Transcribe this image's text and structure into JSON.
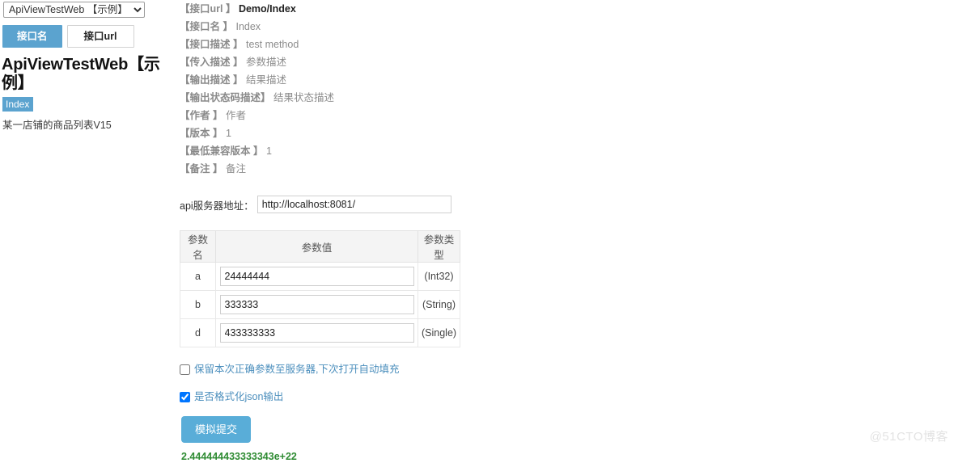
{
  "sidebar": {
    "select": {
      "selected": "ApiViewTestWeb 【示例】",
      "options": [
        "ApiViewTestWeb 【示例】"
      ]
    },
    "tabs": [
      {
        "label": "接口名",
        "active": true
      },
      {
        "label": "接口url",
        "active": false
      }
    ],
    "title": "ApiViewTestWeb【示例】",
    "badge": "Index",
    "description": "某一店铺的商品列表V15"
  },
  "main": {
    "meta": [
      {
        "key": "【接口url 】",
        "value": "Demo/Index",
        "strong": true
      },
      {
        "key": "【接口名 】",
        "value": "Index",
        "strong": false
      },
      {
        "key": "【接口描述 】",
        "value": "test method",
        "strong": false
      },
      {
        "key": "【传入描述 】",
        "value": "参数描述",
        "strong": false
      },
      {
        "key": "【输出描述 】",
        "value": "结果描述",
        "strong": false
      },
      {
        "key": "【输出状态码描述】",
        "value": "结果状态描述",
        "strong": false
      },
      {
        "key": "【作者 】",
        "value": "作者",
        "strong": false
      },
      {
        "key": "【版本 】",
        "value": "1",
        "strong": false
      },
      {
        "key": "【最低兼容版本 】",
        "value": "1",
        "strong": false
      },
      {
        "key": "【备注 】",
        "value": "备注",
        "strong": false
      }
    ],
    "server": {
      "label": "api服务器地址：",
      "value": "http://localhost:8081/"
    },
    "table": {
      "headers": [
        "参数名",
        "参数值",
        "参数类型"
      ],
      "rows": [
        {
          "name": "a",
          "value": "24444444",
          "type": "(Int32)"
        },
        {
          "name": "b",
          "value": "333333",
          "type": "(String)"
        },
        {
          "name": "d",
          "value": "433333333",
          "type": "(Single)"
        }
      ]
    },
    "checkboxes": [
      {
        "label": "保留本次正确参数至服务器,下次打开自动填充",
        "checked": false
      },
      {
        "label": "是否格式化json输出",
        "checked": true
      }
    ],
    "submit_label": "模拟提交",
    "result": "2.444444433333343e+22"
  },
  "watermark": "@51CTO博客",
  "colors": {
    "accent_blue": "#5ba3cf",
    "button_blue": "#59add8",
    "link_blue": "#4c8fbd",
    "result_green": "#2e8b32",
    "table_header_bg": "#f4f4f4"
  }
}
